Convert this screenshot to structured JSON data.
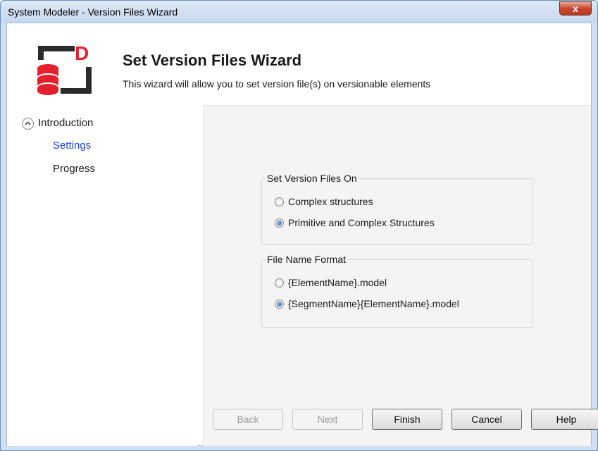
{
  "window": {
    "title": "System Modeler - Version Files Wizard",
    "close_label": "x"
  },
  "header": {
    "title": "Set Version Files Wizard",
    "description": "This wizard will allow you to set version file(s) on versionable elements",
    "logo_letter": "D"
  },
  "nav": {
    "intro_label": "Introduction",
    "settings_label": "Settings",
    "progress_label": "Progress"
  },
  "settings": {
    "version_files_on": {
      "legend": "Set Version Files On",
      "options": [
        "Complex structures",
        "Primitive and Complex Structures"
      ],
      "selected": "Primitive and Complex Structures"
    },
    "file_name_format": {
      "legend": "File Name Format",
      "options": [
        "{ElementName}.model",
        "{SegmentName}{ElementName}.model"
      ],
      "selected": "{SegmentName}{ElementName}.model"
    }
  },
  "buttons": {
    "back": "Back",
    "next": "Next",
    "finish": "Finish",
    "cancel": "Cancel",
    "help": "Help"
  },
  "colors": {
    "accent_link": "#2342d8",
    "logo_red": "#e4202e",
    "logo_dark": "#2b2b2b"
  }
}
